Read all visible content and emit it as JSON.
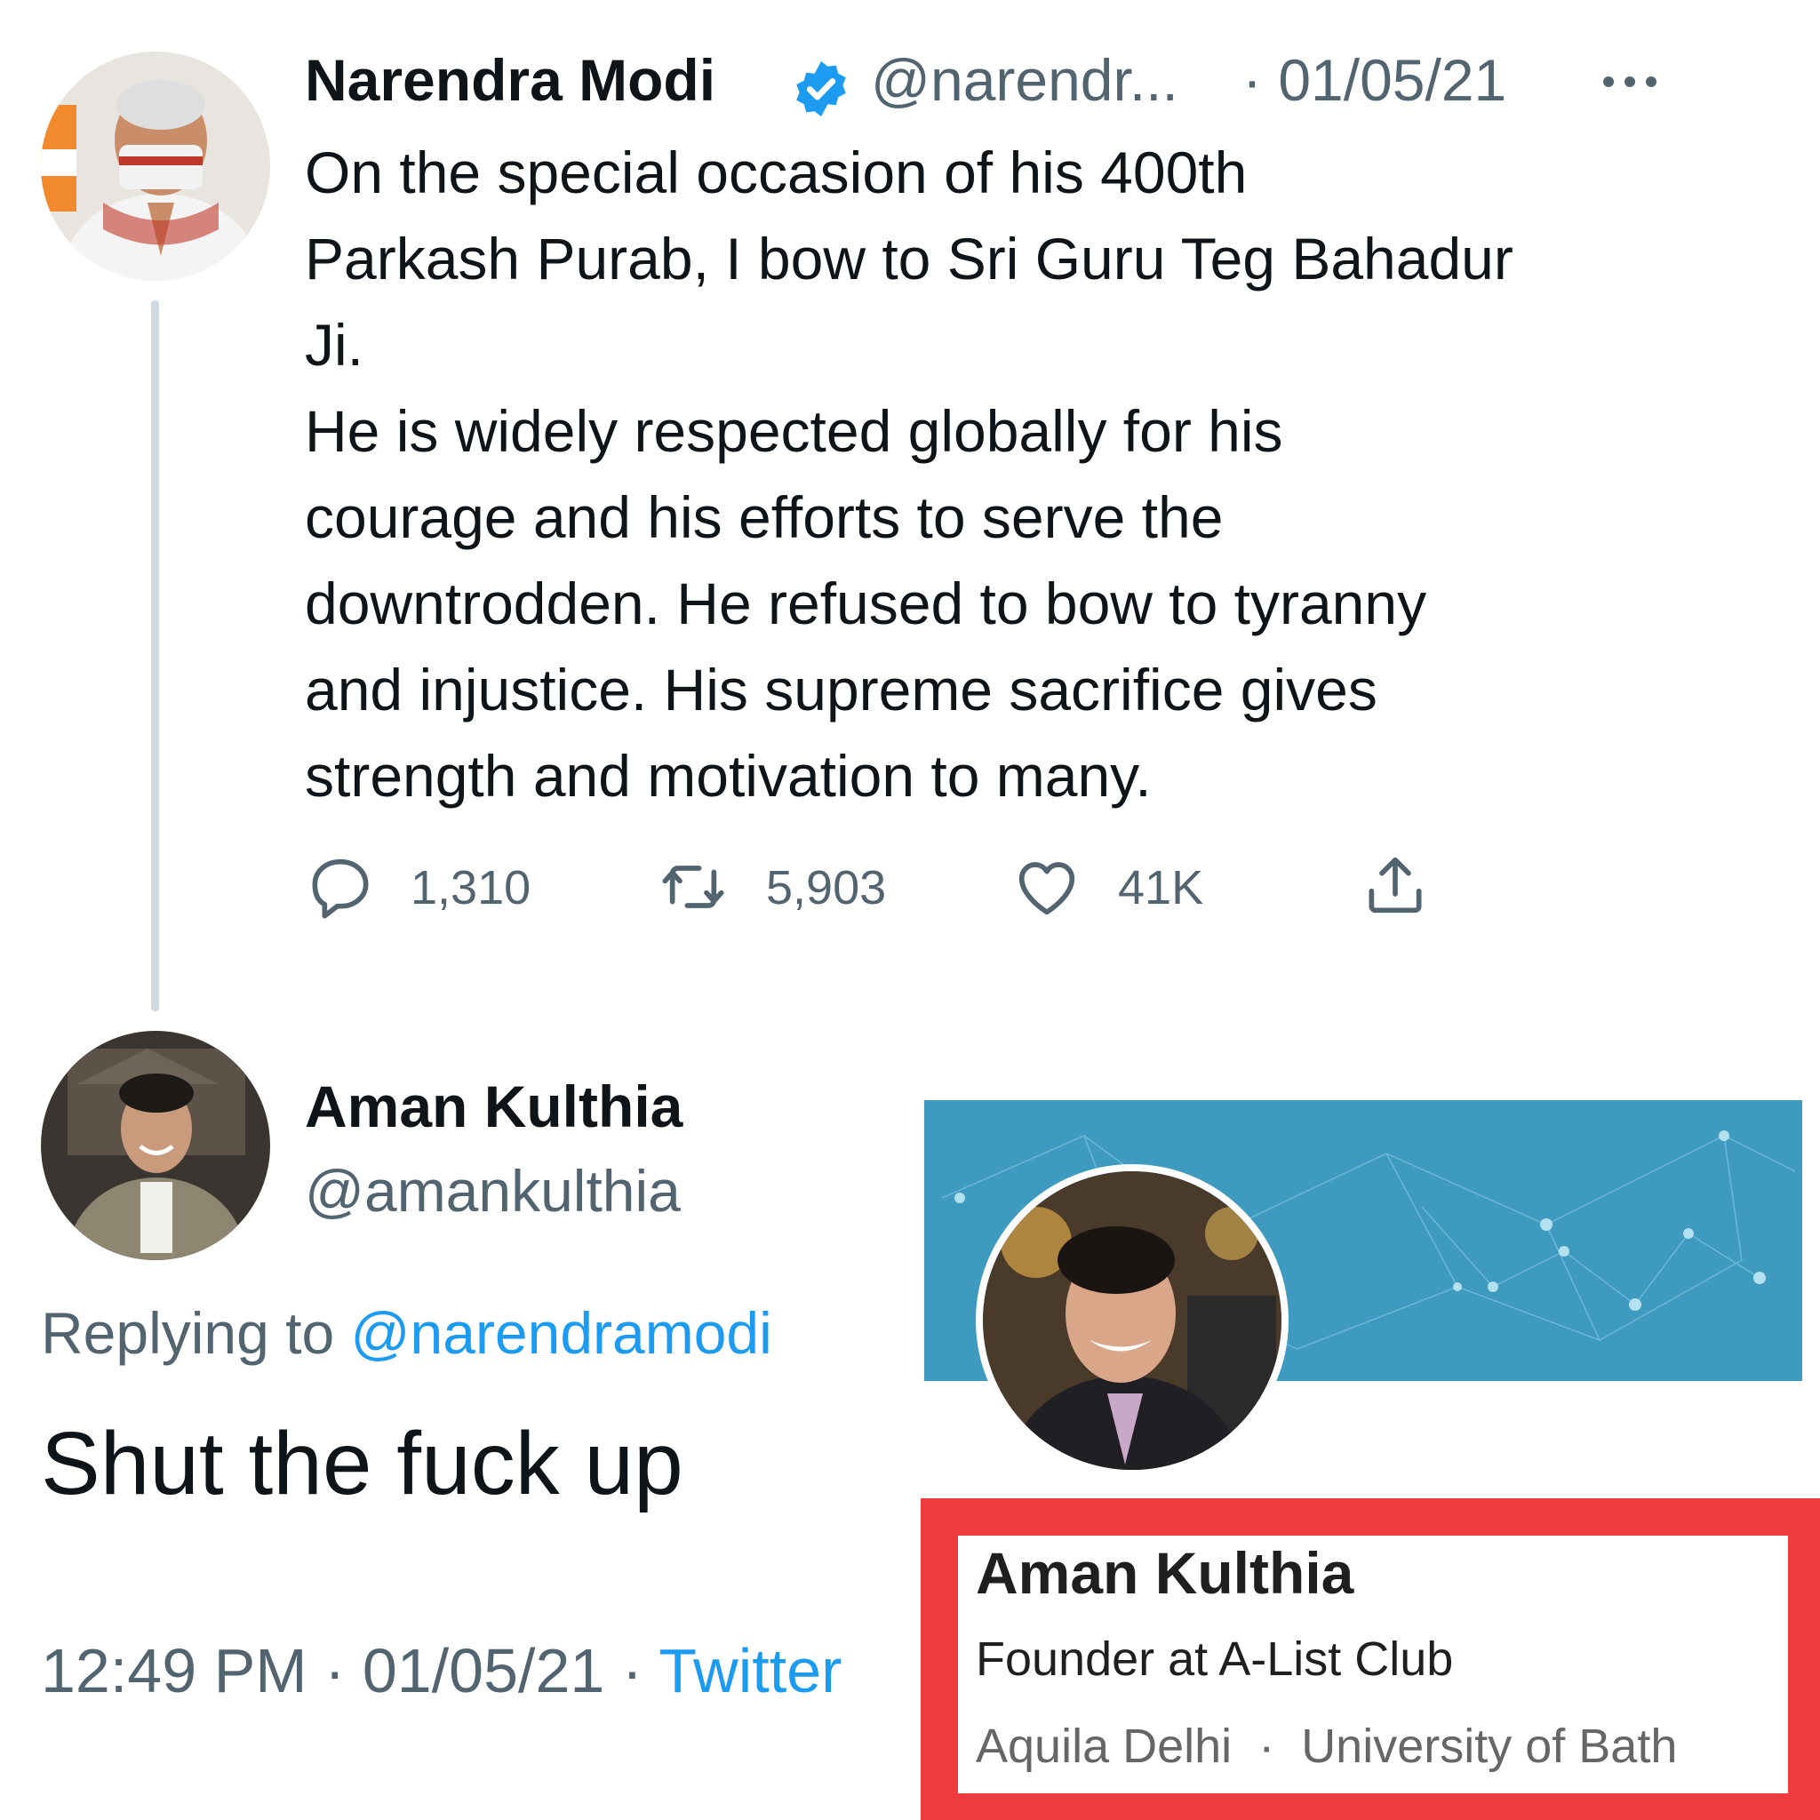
{
  "original_tweet": {
    "author_name": "Narendra Modi",
    "handle": "@narendr...",
    "date": "· 01/05/21",
    "verified_icon": "verified-badge-icon",
    "body_lines": [
      "On the special occasion of his 400th",
      "Parkash Purab, I bow to Sri Guru Teg Bahadur",
      "Ji.",
      "He is widely respected globally for his",
      "courage and his efforts to serve the",
      "downtrodden. He refused to bow to tyranny",
      "and injustice. His supreme sacrifice gives",
      "strength and motivation to many."
    ],
    "actions": {
      "replies": "1,310",
      "retweets": "5,903",
      "likes": "41K"
    }
  },
  "reply_tweet": {
    "author_name": "Aman Kulthia",
    "handle": "@amankulthia",
    "replying_prefix": "Replying to ",
    "replying_to": "@narendramodi",
    "text": "Shut the fuck up",
    "time": "12:49 PM",
    "date": "01/05/21",
    "separator": " · ",
    "source": "Twitter"
  },
  "profile_card": {
    "name": "Aman Kulthia",
    "headline": "Founder at A-List Club",
    "location": "Aquila Delhi",
    "separator": "·",
    "education": "University of Bath"
  },
  "colors": {
    "link_blue": "#1d9bf0",
    "secondary_text": "#536471",
    "banner_blue": "#3f9ac0",
    "frame_red": "#ee3b40"
  }
}
